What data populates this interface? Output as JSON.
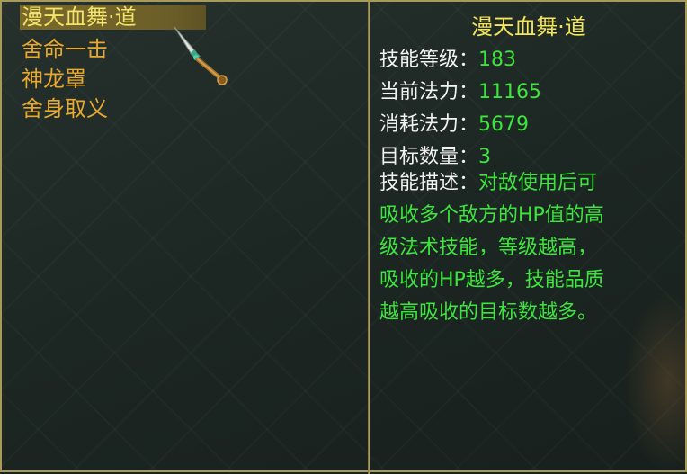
{
  "skill_list": [
    {
      "label": "漫天血舞·道",
      "selected": true
    },
    {
      "label": "舍命一击",
      "selected": false
    },
    {
      "label": "神龙罩",
      "selected": false
    },
    {
      "label": "舍身取义",
      "selected": false
    }
  ],
  "detail": {
    "title": "漫天血舞·道",
    "level_label": "技能等级：",
    "level_value": "183",
    "current_mp_label": "当前法力：",
    "current_mp_value": "11165",
    "cost_mp_label": "消耗法力：",
    "cost_mp_value": "5679",
    "target_count_label": "目标数量：",
    "target_count_value": "3",
    "desc_label": "技能描述：",
    "desc_first": "对敌使用后可",
    "desc_lines": [
      "吸收多个敌方的HP值的高",
      "级法术技能，等级越高，",
      "吸收的HP越多，技能品质",
      "越高吸收的目标数越多。"
    ]
  },
  "icons": {
    "cursor": "dagger-cursor-icon"
  },
  "colors": {
    "label": "#f2f2f2",
    "value": "#3ee43e",
    "title": "#f5e55a",
    "skill": "#e8a92c",
    "border": "#a89a5a"
  }
}
